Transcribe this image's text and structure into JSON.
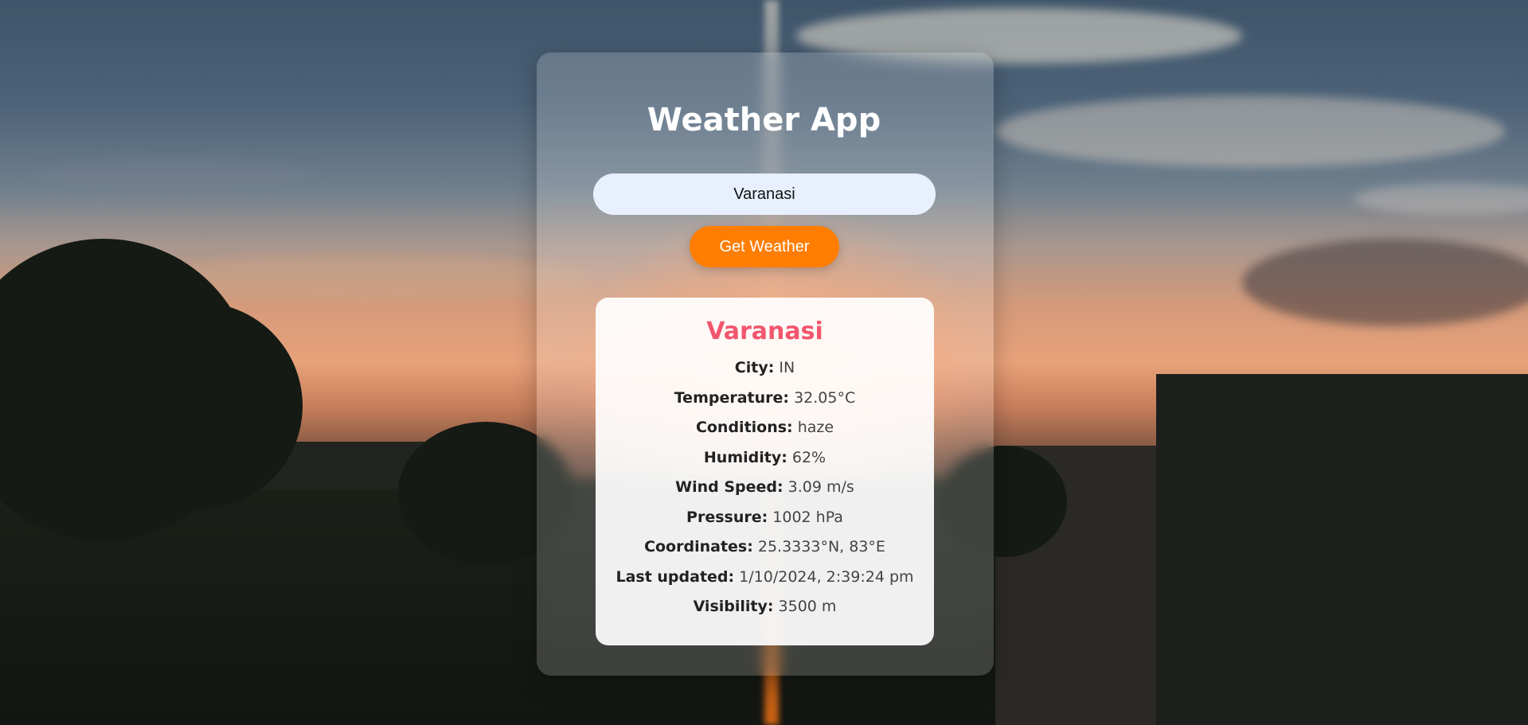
{
  "app": {
    "title": "Weather App",
    "accent_color": "#ff7d00",
    "city_name_color": "#f2566e"
  },
  "search": {
    "value": "Varanasi",
    "button_label": "Get Weather"
  },
  "result": {
    "city_heading": "Varanasi",
    "rows": [
      {
        "label": "City:",
        "value": "IN"
      },
      {
        "label": "Temperature:",
        "value": "32.05°C"
      },
      {
        "label": "Conditions:",
        "value": "haze"
      },
      {
        "label": "Humidity:",
        "value": "62%"
      },
      {
        "label": "Wind Speed:",
        "value": "3.09 m/s"
      },
      {
        "label": "Pressure:",
        "value": "1002 hPa"
      },
      {
        "label": "Coordinates:",
        "value": "25.3333°N, 83°E"
      },
      {
        "label": "Last updated:",
        "value": "1/10/2024, 2:39:24 pm"
      },
      {
        "label": "Visibility:",
        "value": "3500 m"
      }
    ]
  }
}
